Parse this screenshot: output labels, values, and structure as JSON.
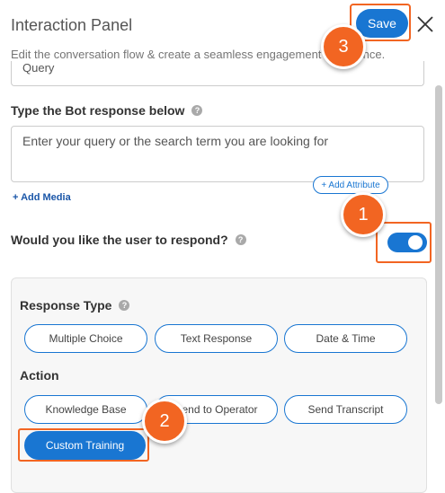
{
  "header": {
    "title": "Interaction Panel",
    "subtitle": "Edit the conversation flow & create a seamless engagement experience.",
    "save_label": "Save"
  },
  "query_field": {
    "value": "Query"
  },
  "bot_response": {
    "label": "Type the Bot response below",
    "placeholder": "Enter your query or the search term you are looking for",
    "add_media": "+ Add Media",
    "add_attribute": "+ Add Attribute"
  },
  "respond": {
    "label": "Would you like the user to respond?",
    "enabled": true
  },
  "response_type": {
    "label": "Response Type",
    "options": [
      "Multiple Choice",
      "Text Response",
      "Date & Time"
    ]
  },
  "action": {
    "label": "Action",
    "options": [
      "Knowledge Base",
      "Send to Operator",
      "Send Transcript",
      "Custom Training"
    ],
    "selected": "Custom Training"
  },
  "callouts": [
    "1",
    "2",
    "3"
  ],
  "colors": {
    "accent": "#1976d2",
    "callout": "#f26522"
  }
}
